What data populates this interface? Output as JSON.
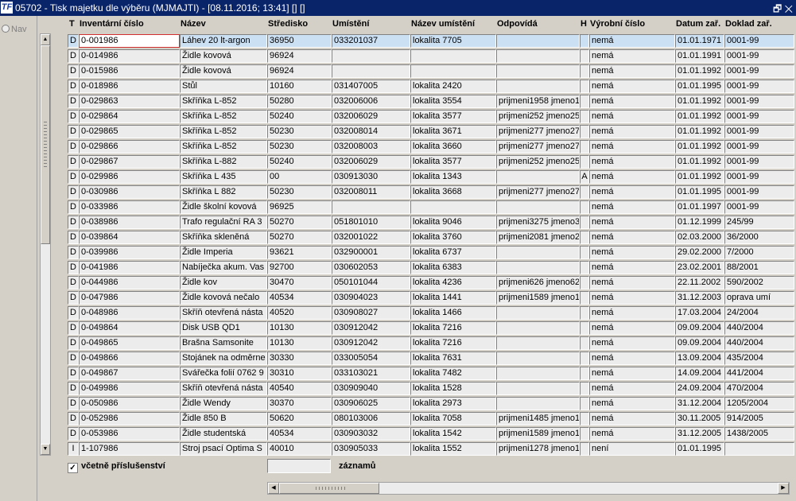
{
  "window": {
    "app_icon_text": "TF",
    "title": "05702 - Tisk majetku dle výběru (MJMAJTI) - [08.11.2016; 13:41]  []  []",
    "controls": "🗗 ✕"
  },
  "nav": {
    "label": "Nav"
  },
  "columns": {
    "t": "T",
    "inv": "Inventární číslo",
    "naz": "Název",
    "str": "Středisko",
    "umi": "Umístění",
    "num": "Název umístění",
    "odp": "Odpovídá",
    "h": "H",
    "vyr": "Výrobní číslo",
    "dat": "Datum zař.",
    "dok": "Doklad zař."
  },
  "rows": [
    {
      "t": "D",
      "inv": "0-001986",
      "naz": "Láhev 20 lt-argon",
      "str": "36950",
      "umi": "033201037",
      "num": "lokalita 7705",
      "odp": "",
      "h": "",
      "vyr": "nemá",
      "dat": "01.01.1971",
      "dok": "0001-99"
    },
    {
      "t": "D",
      "inv": "0-014986",
      "naz": "Židle kovová",
      "str": "96924",
      "umi": "",
      "num": "",
      "odp": "",
      "h": "",
      "vyr": "nemá",
      "dat": "01.01.1991",
      "dok": "0001-99"
    },
    {
      "t": "D",
      "inv": "0-015986",
      "naz": "Židle kovová",
      "str": "96924",
      "umi": "",
      "num": "",
      "odp": "",
      "h": "",
      "vyr": "nemá",
      "dat": "01.01.1992",
      "dok": "0001-99"
    },
    {
      "t": "D",
      "inv": "0-018986",
      "naz": "Stůl",
      "str": "10160",
      "umi": "031407005",
      "num": "lokalita 2420",
      "odp": "",
      "h": "",
      "vyr": "nemá",
      "dat": "01.01.1995",
      "dok": "0001-99"
    },
    {
      "t": "D",
      "inv": "0-029863",
      "naz": "Skříňka L-852",
      "str": "50280",
      "umi": "032006006",
      "num": "lokalita 3554",
      "odp": "prijmeni1958 jmeno19",
      "h": "",
      "vyr": "nemá",
      "dat": "01.01.1992",
      "dok": "0001-99"
    },
    {
      "t": "D",
      "inv": "0-029864",
      "naz": "Skříňka L-852",
      "str": "50240",
      "umi": "032006029",
      "num": "lokalita 3577",
      "odp": "prijmeni252 jmeno252",
      "h": "",
      "vyr": "nemá",
      "dat": "01.01.1992",
      "dok": "0001-99"
    },
    {
      "t": "D",
      "inv": "0-029865",
      "naz": "Skříňka L-852",
      "str": "50230",
      "umi": "032008014",
      "num": "lokalita 3671",
      "odp": "prijmeni277 jmeno277",
      "h": "",
      "vyr": "nemá",
      "dat": "01.01.1992",
      "dok": "0001-99"
    },
    {
      "t": "D",
      "inv": "0-029866",
      "naz": "Skříňka L-852",
      "str": "50230",
      "umi": "032008003",
      "num": "lokalita 3660",
      "odp": "prijmeni277 jmeno277",
      "h": "",
      "vyr": "nemá",
      "dat": "01.01.1992",
      "dok": "0001-99"
    },
    {
      "t": "D",
      "inv": "0-029867",
      "naz": "Skříňka L-882",
      "str": "50240",
      "umi": "032006029",
      "num": "lokalita 3577",
      "odp": "prijmeni252 jmeno252",
      "h": "",
      "vyr": "nemá",
      "dat": "01.01.1992",
      "dok": "0001-99"
    },
    {
      "t": "D",
      "inv": "0-029986",
      "naz": "Skříňka L 435",
      "str": "00",
      "umi": "030913030",
      "num": "lokalita 1343",
      "odp": "",
      "h": "A",
      "vyr": "nemá",
      "dat": "01.01.1992",
      "dok": "0001-99"
    },
    {
      "t": "D",
      "inv": "0-030986",
      "naz": "Skříňka L 882",
      "str": "50230",
      "umi": "032008011",
      "num": "lokalita 3668",
      "odp": "prijmeni277 jmeno277",
      "h": "",
      "vyr": "nemá",
      "dat": "01.01.1995",
      "dok": "0001-99"
    },
    {
      "t": "D",
      "inv": "0-033986",
      "naz": "Židle školní kovová",
      "str": "96925",
      "umi": "",
      "num": "",
      "odp": "",
      "h": "",
      "vyr": "nemá",
      "dat": "01.01.1997",
      "dok": "0001-99"
    },
    {
      "t": "D",
      "inv": "0-038986",
      "naz": "Trafo regulační RA 3",
      "str": "50270",
      "umi": "051801010",
      "num": "lokalita 9046",
      "odp": "prijmeni3275 jmeno32",
      "h": "",
      "vyr": "nemá",
      "dat": "01.12.1999",
      "dok": "245/99"
    },
    {
      "t": "D",
      "inv": "0-039864",
      "naz": "Skříňka skleněná",
      "str": "50270",
      "umi": "032001022",
      "num": "lokalita 3760",
      "odp": "prijmeni2081 jmeno20",
      "h": "",
      "vyr": "nemá",
      "dat": "02.03.2000",
      "dok": "36/2000"
    },
    {
      "t": "D",
      "inv": "0-039986",
      "naz": "Židle Imperia",
      "str": "93621",
      "umi": "032900001",
      "num": "lokalita 6737",
      "odp": "",
      "h": "",
      "vyr": "nemá",
      "dat": "29.02.2000",
      "dok": "7/2000"
    },
    {
      "t": "D",
      "inv": "0-041986",
      "naz": "Nabíječka akum. Vas",
      "str": "92700",
      "umi": "030602053",
      "num": "lokalita 6383",
      "odp": "",
      "h": "",
      "vyr": "nemá",
      "dat": "23.02.2001",
      "dok": "88/2001"
    },
    {
      "t": "D",
      "inv": "0-044986",
      "naz": "Židle kov",
      "str": "30470",
      "umi": "050101044",
      "num": "lokalita 4236",
      "odp": "prijmeni626 jmeno626",
      "h": "",
      "vyr": "nemá",
      "dat": "22.11.2002",
      "dok": "590/2002"
    },
    {
      "t": "D",
      "inv": "0-047986",
      "naz": "Židle kovová nečalo",
      "str": "40534",
      "umi": "030904023",
      "num": "lokalita 1441",
      "odp": "prijmeni1589 jmeno15",
      "h": "",
      "vyr": "nemá",
      "dat": "31.12.2003",
      "dok": "oprava umí"
    },
    {
      "t": "D",
      "inv": "0-048986",
      "naz": "Skříň otevřená násta",
      "str": "40520",
      "umi": "030908027",
      "num": "lokalita 1466",
      "odp": "",
      "h": "",
      "vyr": "nemá",
      "dat": "17.03.2004",
      "dok": "24/2004"
    },
    {
      "t": "D",
      "inv": "0-049864",
      "naz": "Disk USB QD1",
      "str": "10130",
      "umi": "030912042",
      "num": "lokalita 7216",
      "odp": "",
      "h": "",
      "vyr": "nemá",
      "dat": "09.09.2004",
      "dok": "440/2004"
    },
    {
      "t": "D",
      "inv": "0-049865",
      "naz": "Brašna Samsonite",
      "str": "10130",
      "umi": "030912042",
      "num": "lokalita 7216",
      "odp": "",
      "h": "",
      "vyr": "nemá",
      "dat": "09.09.2004",
      "dok": "440/2004"
    },
    {
      "t": "D",
      "inv": "0-049866",
      "naz": "Stojánek na odměrne",
      "str": "30330",
      "umi": "033005054",
      "num": "lokalita 7631",
      "odp": "",
      "h": "",
      "vyr": "nemá",
      "dat": "13.09.2004",
      "dok": "435/2004"
    },
    {
      "t": "D",
      "inv": "0-049867",
      "naz": "Svářečka folií 0762 9",
      "str": "30310",
      "umi": "033103021",
      "num": "lokalita 7482",
      "odp": "",
      "h": "",
      "vyr": "nemá",
      "dat": "14.09.2004",
      "dok": "441/2004"
    },
    {
      "t": "D",
      "inv": "0-049986",
      "naz": "Skříň otevřená násta",
      "str": "40540",
      "umi": "030909040",
      "num": "lokalita 1528",
      "odp": "",
      "h": "",
      "vyr": "nemá",
      "dat": "24.09.2004",
      "dok": "470/2004"
    },
    {
      "t": "D",
      "inv": "0-050986",
      "naz": "Židle Wendy",
      "str": "30370",
      "umi": "030906025",
      "num": "lokalita 2973",
      "odp": "",
      "h": "",
      "vyr": "nemá",
      "dat": "31.12.2004",
      "dok": "1205/2004"
    },
    {
      "t": "D",
      "inv": "0-052986",
      "naz": "Židle 850 B",
      "str": "50620",
      "umi": "080103006",
      "num": "lokalita 7058",
      "odp": "prijmeni1485 jmeno14",
      "h": "",
      "vyr": "nemá",
      "dat": "30.11.2005",
      "dok": "914/2005"
    },
    {
      "t": "D",
      "inv": "0-053986",
      "naz": "Židle studentská",
      "str": "40534",
      "umi": "030903032",
      "num": "lokalita 1542",
      "odp": "prijmeni1589 jmeno15",
      "h": "",
      "vyr": "nemá",
      "dat": "31.12.2005",
      "dok": "1438/2005"
    },
    {
      "t": "I",
      "inv": "1-107986",
      "naz": "Stroj psací Optima S",
      "str": "40010",
      "umi": "030905033",
      "num": "lokalita 1552",
      "odp": "prijmeni1278 jmeno12",
      "h": "",
      "vyr": "není",
      "dat": "01.01.1995",
      "dok": ""
    }
  ],
  "footer": {
    "checkbox_label": "včetně příslušenství",
    "checkbox_checked": true,
    "checkbox_mark": "✓",
    "count_value": "",
    "count_label": "záznamů"
  },
  "scroll": {
    "up": "▲",
    "down": "▼",
    "left": "◀",
    "right": "▶"
  }
}
